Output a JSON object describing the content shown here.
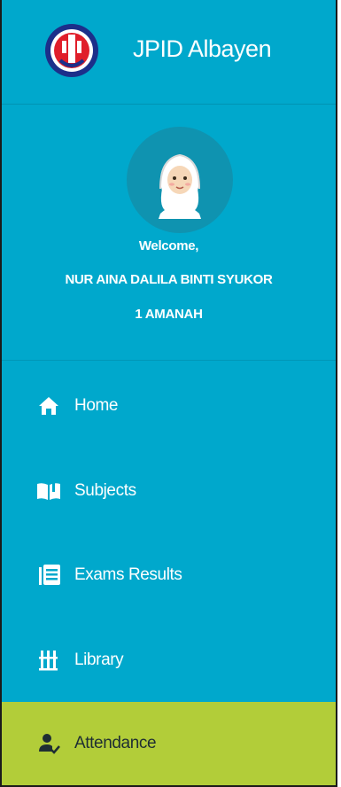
{
  "brand": {
    "title": "JPID Albayen",
    "logo_icon": "school-crest-logo"
  },
  "profile": {
    "avatar_icon": "hijab-girl-avatar",
    "welcome": "Welcome,",
    "name": "NUR AINA DALILA BINTI SYUKOR",
    "class": "1 AMANAH"
  },
  "nav": {
    "items": [
      {
        "label": "Home",
        "icon": "home-icon",
        "active": false
      },
      {
        "label": "Subjects",
        "icon": "book-icon",
        "active": false
      },
      {
        "label": "Exams Results",
        "icon": "list-icon",
        "active": false
      },
      {
        "label": "Library",
        "icon": "library-icon",
        "active": false
      },
      {
        "label": "Attendance",
        "icon": "user-check-icon",
        "active": true
      }
    ]
  },
  "colors": {
    "sidebar_bg": "#00a8cc",
    "active_bg": "#b2cd39",
    "text": "#ffffff"
  }
}
